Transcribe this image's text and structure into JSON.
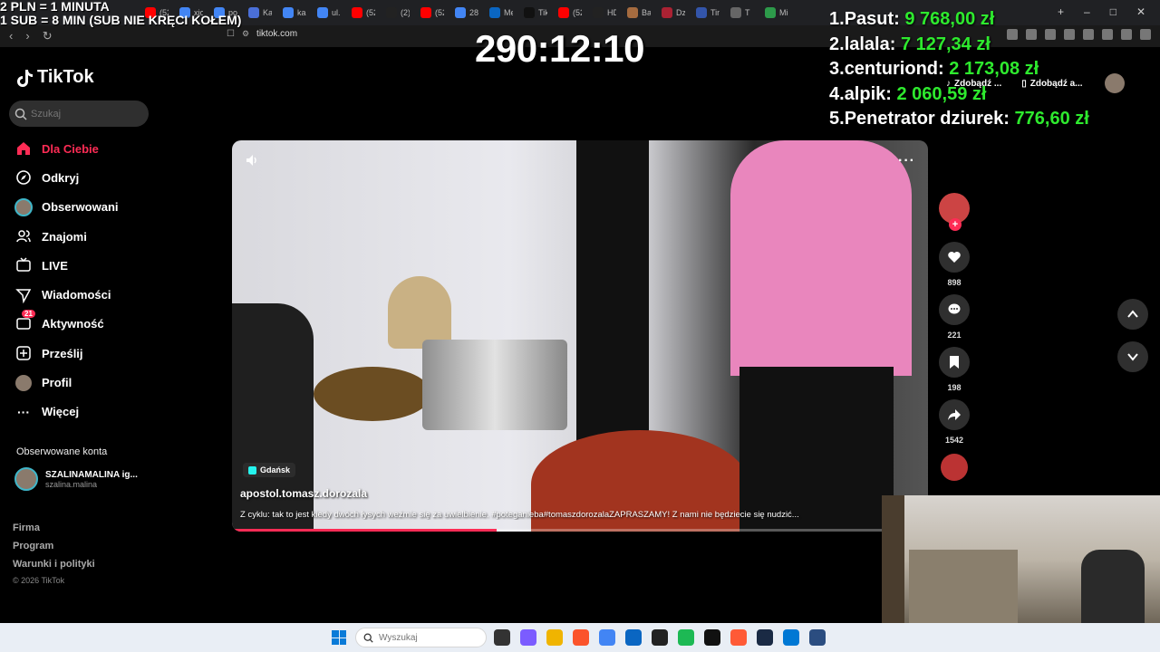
{
  "stream_overlay": {
    "line1": "2 PLN = 1 MINUTA",
    "line2": "1 SUB = 8 MIN (SUB NIE KRĘCI KOŁEM)",
    "timer": "290:12:10"
  },
  "leaderboard": [
    {
      "rank": "1.",
      "name": "Pasut:",
      "amount": "9 768,00 zł"
    },
    {
      "rank": "2.",
      "name": "lalala:",
      "amount": "7 127,34 zł"
    },
    {
      "rank": "3.",
      "name": "centuriond:",
      "amount": "2 173,08 zł"
    },
    {
      "rank": "4.",
      "name": "alpik:",
      "amount": "2 060,59 zł"
    },
    {
      "rank": "5.",
      "name": "Penetrator dziurek:",
      "amount": "776,60 zł"
    }
  ],
  "browser": {
    "tabs": [
      {
        "label": "(52)",
        "color": "#ff0000"
      },
      {
        "label": "xjoy",
        "color": "#4285f4"
      },
      {
        "label": "poc",
        "color": "#4285f4"
      },
      {
        "label": "Kale",
        "color": "#4a6fd8"
      },
      {
        "label": "kan",
        "color": "#4285f4"
      },
      {
        "label": "ul. V",
        "color": "#4285f4"
      },
      {
        "label": "(52)",
        "color": "#ff0000"
      },
      {
        "label": "(2) J",
        "color": "#222222"
      },
      {
        "label": "(52)",
        "color": "#ff0000"
      },
      {
        "label": "28 u",
        "color": "#4285f4"
      },
      {
        "label": "Mec",
        "color": "#0a66c2"
      },
      {
        "label": "TikT",
        "color": "#111111"
      },
      {
        "label": "(52)",
        "color": "#ff0000"
      },
      {
        "label": "HD",
        "color": "#222222"
      },
      {
        "label": "Bab",
        "color": "#a56b3f"
      },
      {
        "label": "Dzi",
        "color": "#aa2233"
      },
      {
        "label": "Tin",
        "color": "#3355aa"
      },
      {
        "label": "T",
        "color": "#666666"
      },
      {
        "label": "Mie",
        "color": "#2d9a4a"
      }
    ],
    "url": "tiktok.com"
  },
  "tiktok": {
    "logo": "TikTok",
    "search_placeholder": "Szukaj",
    "nav": [
      {
        "label": "Dla Ciebie",
        "icon": "home-icon",
        "active": true
      },
      {
        "label": "Odkryj",
        "icon": "compass-icon"
      },
      {
        "label": "Obserwowani",
        "icon": "avatar-icon"
      },
      {
        "label": "Znajomi",
        "icon": "friends-icon"
      },
      {
        "label": "LIVE",
        "icon": "live-icon"
      },
      {
        "label": "Wiadomości",
        "icon": "message-icon"
      },
      {
        "label": "Aktywność",
        "icon": "activity-icon",
        "badge": "21"
      },
      {
        "label": "Prześlij",
        "icon": "upload-icon"
      },
      {
        "label": "Profil",
        "icon": "profile-icon"
      },
      {
        "label": "Więcej",
        "icon": "more-icon"
      }
    ],
    "followed_title": "Obserwowane konta",
    "followed_account": {
      "name": "SZALINAMALINA ig...",
      "handle": "szalina.malina"
    },
    "footer": [
      "Firma",
      "Program",
      "Warunki i polityki"
    ],
    "copyright": "© 2026 TikTok",
    "get_app": [
      "Zdobądź ...",
      "Zdobądź a..."
    ],
    "video": {
      "location": "Gdańsk",
      "author": "apostol.tomasz.dorozala",
      "description": "Z cyklu: tak to jest kiedy dwóch łysych weźmie się za uwielbienie. #poteganieba#tomaszdorozalaZAPRASZAMY! Z nami nie będziecie się nudzić...",
      "progress_fraction": 0.38
    },
    "actions": {
      "likes": "898",
      "comments": "221",
      "saves": "198",
      "shares": "1542"
    }
  },
  "taskbar": {
    "search_placeholder": "Wyszukaj",
    "apps": [
      "#333333",
      "#7b5cff",
      "#f0b400",
      "#fb542b",
      "#4285f4",
      "#0a66c2",
      "#222222",
      "#1db954",
      "#111111",
      "#ff5a36",
      "#1a2a44",
      "#0078d4",
      "#2b4d80"
    ]
  },
  "colors": {
    "accent": "#fe2c55",
    "money": "#2eea2e"
  }
}
